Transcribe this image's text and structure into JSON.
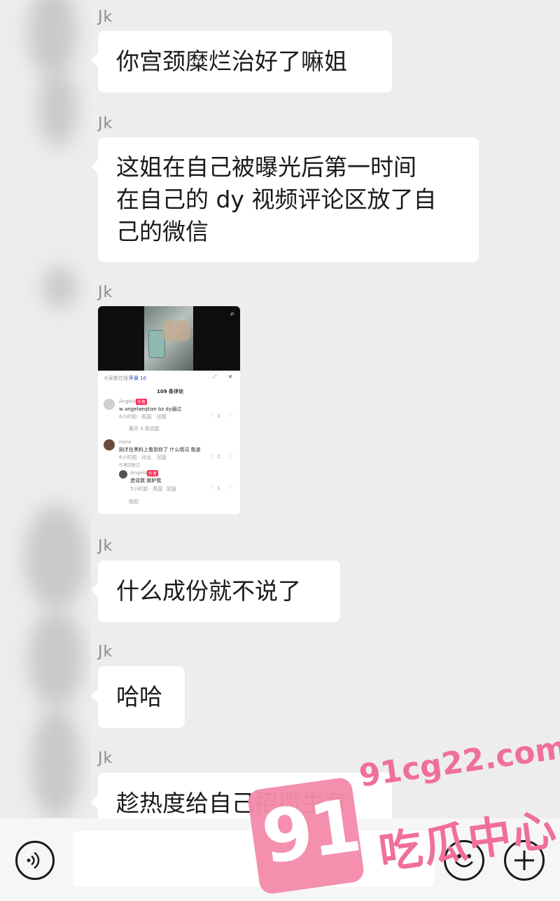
{
  "messages": [
    {
      "sender": "Jk",
      "lines": [
        "你宫颈糜烂治好了嘛姐"
      ]
    },
    {
      "sender": "Jk",
      "lines": [
        "这姐在自己被曝光后第一时间",
        "在自己的 dy 视频评论区放了自",
        "己的微信"
      ]
    },
    {
      "sender": "Jk",
      "type": "image"
    },
    {
      "sender": "Jk",
      "lines": [
        "什么成份就不说了"
      ]
    },
    {
      "sender": "Jk",
      "lines": [
        "哈哈"
      ]
    },
    {
      "sender": "Jk",
      "lines": [
        "趁热度给自己招揽生意"
      ]
    }
  ],
  "screenshot": {
    "banner_prefix": "大家都在搜：",
    "banner_query": "苹果 16",
    "comment_count": "109 条评论",
    "comments": [
      {
        "user": "Angela",
        "tag": "作者",
        "text": "w angelaeqtian bz dy通过",
        "meta": "6小时前 · 英国",
        "reply": "回复",
        "likes": "3",
        "expand": "展开 4 条回复"
      },
      {
        "user": "nono",
        "tag": "",
        "text": "刚才在黑料上看到你了 什么情况 我波",
        "meta": "6小时前 · 河北",
        "reply": "回复",
        "likes": "2",
        "note": "作者回复过"
      },
      {
        "user": "Angela",
        "tag": "作者",
        "text": "造谣我 嫉妒我",
        "meta": "5小时前 · 英国",
        "reply": "回复",
        "likes": "1",
        "collapse": "收起"
      }
    ]
  },
  "watermark": {
    "badge": "91",
    "url": "91cg22.com",
    "text": "吃瓜中心"
  },
  "icons": {
    "voice": "voice-icon",
    "emoji": "emoji-icon",
    "plus": "plus-icon"
  }
}
